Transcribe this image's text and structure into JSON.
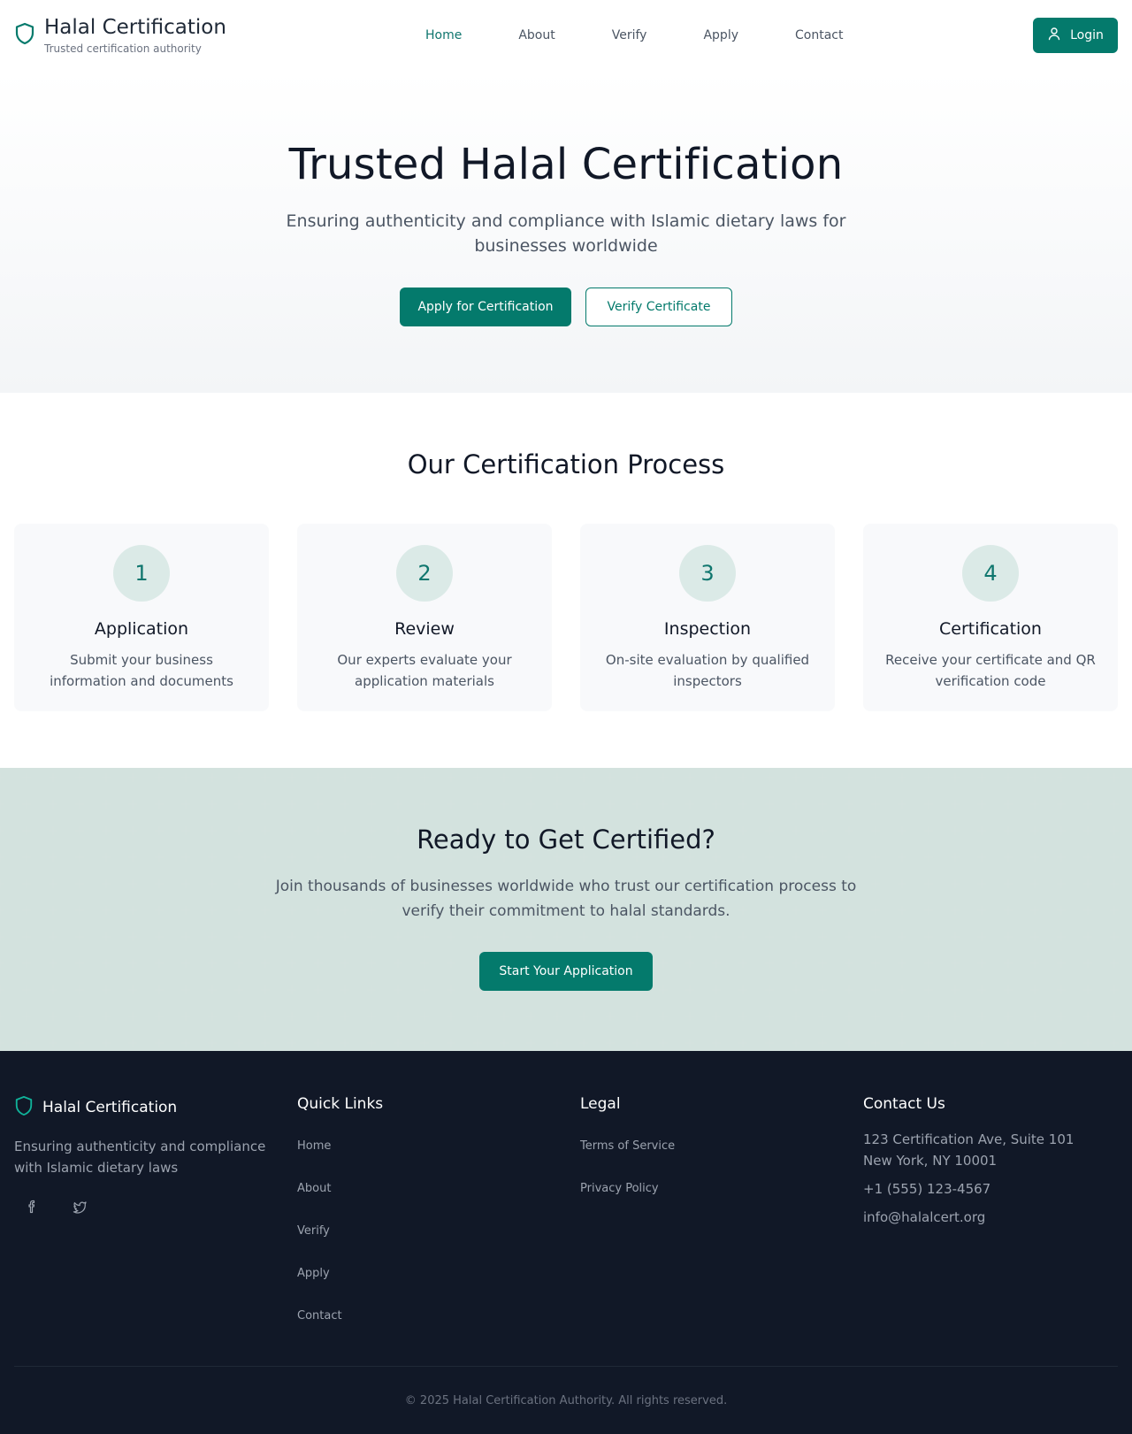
{
  "header": {
    "brand_title": "Halal Certification",
    "brand_subtitle": "Trusted certification authority",
    "nav": [
      {
        "label": "Home",
        "active": true
      },
      {
        "label": "About",
        "active": false
      },
      {
        "label": "Verify",
        "active": false
      },
      {
        "label": "Apply",
        "active": false
      },
      {
        "label": "Contact",
        "active": false
      }
    ],
    "login_label": "Login"
  },
  "hero": {
    "title": "Trusted Halal Certification",
    "subtitle": "Ensuring authenticity and compliance with Islamic dietary laws for businesses worldwide",
    "apply_label": "Apply for Certification",
    "verify_label": "Verify Certificate"
  },
  "process": {
    "title": "Our Certification Process",
    "steps": [
      {
        "number": "1",
        "title": "Application",
        "description": "Submit your business information and documents"
      },
      {
        "number": "2",
        "title": "Review",
        "description": "Our experts evaluate your application materials"
      },
      {
        "number": "3",
        "title": "Inspection",
        "description": "On-site evaluation by qualified inspectors"
      },
      {
        "number": "4",
        "title": "Certification",
        "description": "Receive your certificate and QR verification code"
      }
    ]
  },
  "cta": {
    "title": "Ready to Get Certified?",
    "text": "Join thousands of businesses worldwide who trust our certification process to verify their commitment to halal standards.",
    "button_label": "Start Your Application"
  },
  "footer": {
    "brand_title": "Halal Certification",
    "brand_text": "Ensuring authenticity and compliance with Islamic dietary laws",
    "social": [
      "facebook-icon",
      "twitter-icon"
    ],
    "quick_links_title": "Quick Links",
    "quick_links": [
      "Home",
      "About",
      "Verify",
      "Apply",
      "Contact"
    ],
    "legal_title": "Legal",
    "legal_links": [
      "Terms of Service",
      "Privacy Policy"
    ],
    "contact_title": "Contact Us",
    "address_line1": "123 Certification Ave, Suite 101",
    "address_line2": "New York, NY 10001",
    "phone": "+1 (555) 123-4567",
    "email": "info@halalcert.org",
    "copyright": "© 2025 Halal Certification Authority. All rights reserved."
  },
  "colors": {
    "accent": "#047a6c",
    "footer_bg": "#111827"
  }
}
